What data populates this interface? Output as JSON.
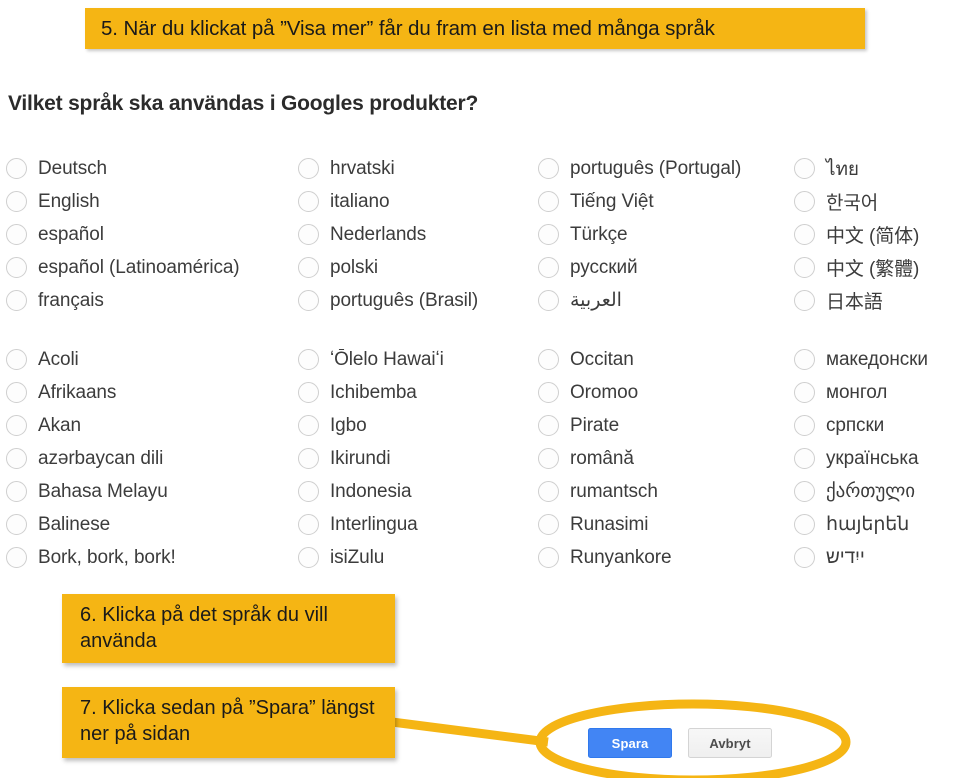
{
  "header": {
    "step_label": "5. När du klickat på ”Visa mer” får du fram en lista med många språk",
    "accent_color": "#F5B514"
  },
  "page": {
    "title": "Vilket språk ska användas i Googles produkter?"
  },
  "language_groups": [
    {
      "name": "primary-languages",
      "columns": [
        [
          "Deutsch",
          "English",
          "español",
          "español (Latinoamérica)",
          "français"
        ],
        [
          "hrvatski",
          "italiano",
          "Nederlands",
          "polski",
          "português (Brasil)"
        ],
        [
          "português (Portugal)",
          "Tiếng Việt",
          "Türkçe",
          "русский",
          "العربية"
        ],
        [
          "ไทย",
          "한국어",
          "中文 (简体)",
          "中文 (繁體)",
          "日本語"
        ]
      ]
    },
    {
      "name": "additional-languages",
      "columns": [
        [
          "Acoli",
          "Afrikaans",
          "Akan",
          "azərbaycan dili",
          "Bahasa Melayu",
          "Balinese",
          "Bork, bork, bork!"
        ],
        [
          "ʻŌlelo Hawaiʻi",
          "Ichibemba",
          "Igbo",
          "Ikirundi",
          "Indonesia",
          "Interlingua",
          "isiZulu"
        ],
        [
          "Occitan",
          "Oromoo",
          "Pirate",
          "română",
          "rumantsch",
          "Runasimi",
          "Runyankore"
        ],
        [
          "македонски",
          "монгол",
          "српски",
          "українська",
          "ქართული",
          "հայերեն",
          "ייִדיש"
        ]
      ]
    }
  ],
  "steps": [
    {
      "name": "step-6",
      "text": "6. Klicka på det språk du vill använda"
    },
    {
      "name": "step-7",
      "text": "7. Klicka sedan på ”Spara” längst ner på sidan"
    }
  ],
  "buttons": {
    "save_label": "Spara",
    "cancel_label": "Avbryt",
    "save_color": "#4285F4",
    "cancel_color": "#F1F1F1"
  },
  "annotation": {
    "highlight_color": "#F5B514",
    "shape": "ellipse-around-buttons"
  }
}
